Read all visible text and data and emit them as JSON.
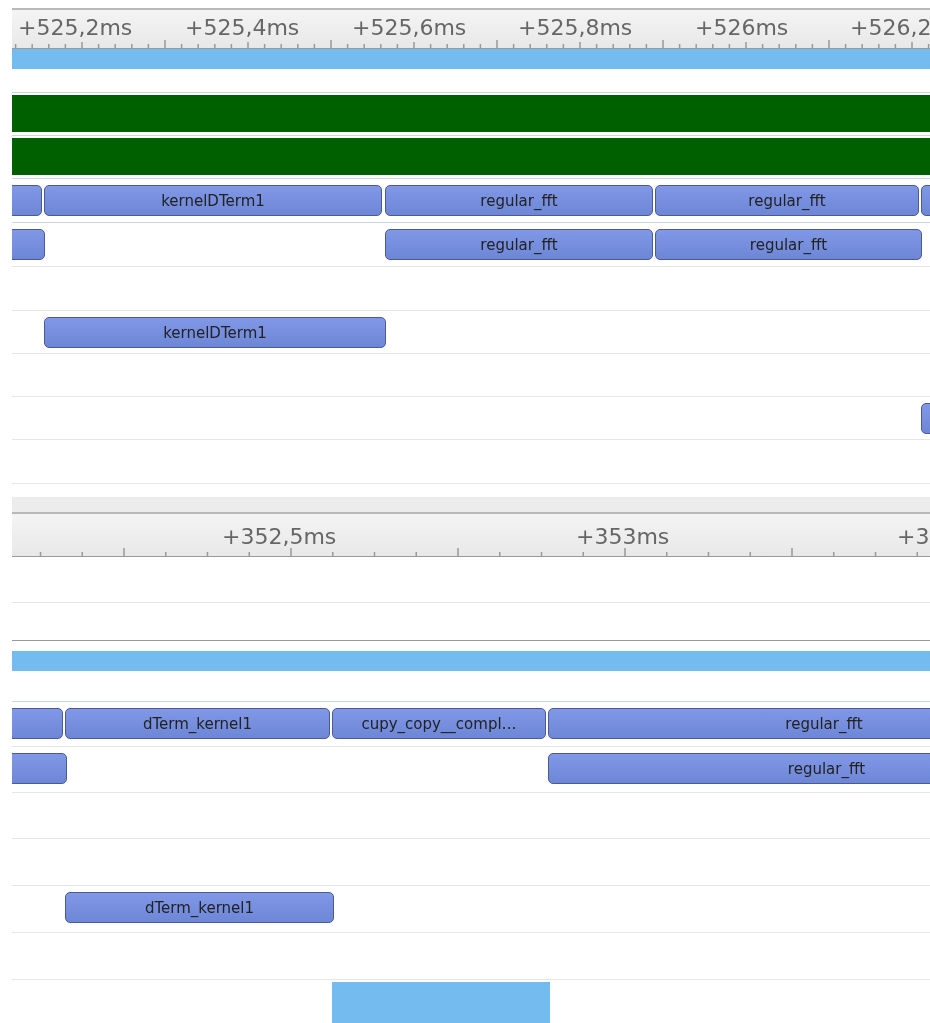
{
  "panels": [
    {
      "ruler": {
        "labels": [
          "+525,2ms",
          "+525,4ms",
          "+525,6ms",
          "+525,8ms",
          "+526ms",
          "+526,2"
        ]
      },
      "rows": [
        {
          "kind": "activity"
        },
        {
          "kind": "range"
        },
        {
          "kind": "range"
        },
        {
          "kind": "lane",
          "bars": [
            {
              "kind": "kernel"
            },
            {
              "kind": "kernel",
              "label": "kernelDTerm1"
            },
            {
              "kind": "kernel",
              "label": "regular_fft"
            },
            {
              "kind": "kernel",
              "label": "regular_fft"
            },
            {
              "kind": "kernel"
            }
          ]
        },
        {
          "kind": "lane",
          "bars": [
            {
              "kind": "kernel"
            },
            {
              "kind": "kernel",
              "label": "regular_fft"
            },
            {
              "kind": "kernel",
              "label": "regular_fft"
            }
          ]
        },
        {
          "kind": "lane",
          "bars": []
        },
        {
          "kind": "lane",
          "bars": [
            {
              "kind": "kernel",
              "label": "kernelDTerm1"
            }
          ]
        },
        {
          "kind": "lane",
          "bars": []
        },
        {
          "kind": "lane",
          "bars": [
            {
              "kind": "kernel"
            }
          ]
        },
        {
          "kind": "lane",
          "bars": []
        }
      ]
    },
    {
      "ruler": {
        "labels": [
          "+352,5ms",
          "+353ms",
          "+3"
        ]
      },
      "rows": [
        {
          "kind": "lane",
          "bars": []
        },
        {
          "kind": "lane",
          "bars": []
        },
        {
          "kind": "activity"
        },
        {
          "kind": "lane",
          "bars": [
            {
              "kind": "kernel"
            },
            {
              "kind": "kernel",
              "label": "dTerm_kernel1"
            },
            {
              "kind": "kernel",
              "label": "cupy_copy__compl…"
            },
            {
              "kind": "kernel",
              "label": "regular_fft"
            }
          ]
        },
        {
          "kind": "lane",
          "bars": [
            {
              "kind": "kernel"
            },
            {
              "kind": "kernel",
              "label": "regular_fft"
            }
          ]
        },
        {
          "kind": "lane",
          "bars": []
        },
        {
          "kind": "lane",
          "bars": []
        },
        {
          "kind": "lane",
          "bars": [
            {
              "kind": "kernel",
              "label": "dTerm_kernel1"
            }
          ]
        },
        {
          "kind": "lane",
          "bars": []
        },
        {
          "kind": "lane",
          "bars": [
            {
              "kind": "transfer"
            }
          ]
        }
      ]
    }
  ]
}
